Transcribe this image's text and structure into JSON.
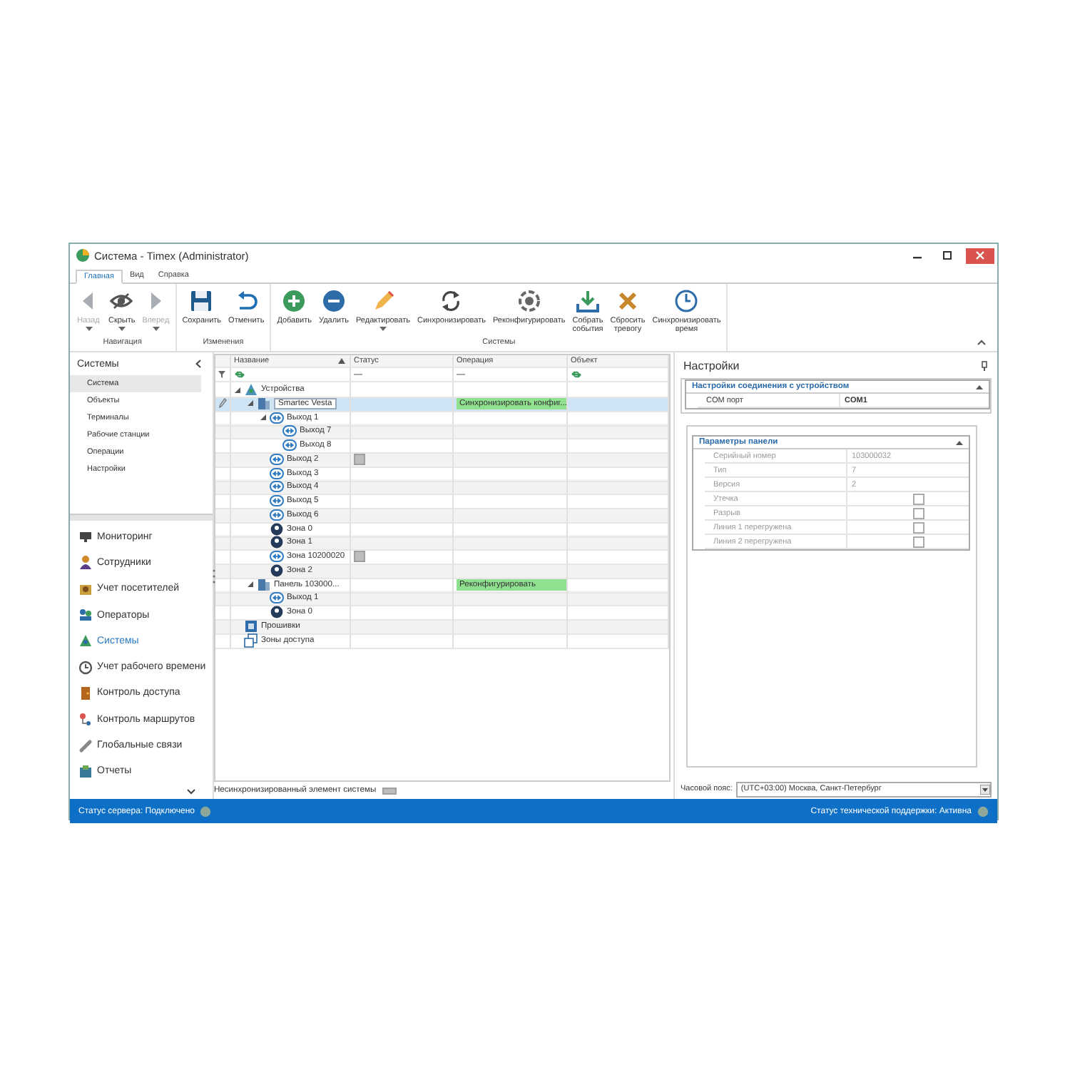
{
  "window": {
    "title": "Система - Timex (Administrator)"
  },
  "ribbon": {
    "tabs": [
      {
        "label": "Главная",
        "selected": true
      },
      {
        "label": "Вид",
        "selected": false
      },
      {
        "label": "Справка",
        "selected": false
      }
    ],
    "groups": [
      {
        "label": "Навигация",
        "buttons": [
          {
            "label": "Назад",
            "disabled": true,
            "dropdown": true
          },
          {
            "label": "Скрыть",
            "disabled": false,
            "dropdown": true
          },
          {
            "label": "Вперед",
            "disabled": true,
            "dropdown": true
          }
        ]
      },
      {
        "label": "Изменения",
        "buttons": [
          {
            "label": "Сохранить",
            "disabled": false,
            "dropdown": false
          },
          {
            "label": "Отменить",
            "disabled": false,
            "dropdown": false
          }
        ]
      },
      {
        "label": "Системы",
        "buttons": [
          {
            "label": "Добавить",
            "disabled": false,
            "dropdown": false
          },
          {
            "label": "Удалить",
            "disabled": false,
            "dropdown": false
          },
          {
            "label": "Редактировать",
            "disabled": false,
            "dropdown": true
          },
          {
            "label": "Синхронизировать",
            "disabled": false,
            "dropdown": false
          },
          {
            "label": "Реконфигурировать",
            "disabled": false,
            "dropdown": false
          },
          {
            "label": "Собрать\nсобытия",
            "disabled": false,
            "dropdown": false
          },
          {
            "label": "Сбросить\nтревогу",
            "disabled": false,
            "dropdown": false
          },
          {
            "label": "Синхронизировать\nвремя",
            "disabled": false,
            "dropdown": false
          }
        ]
      }
    ]
  },
  "nav": {
    "header": "Системы",
    "subitems": [
      {
        "label": "Система",
        "selected": true
      },
      {
        "label": "Объекты",
        "selected": false
      },
      {
        "label": "Терминалы",
        "selected": false
      },
      {
        "label": "Рабочие станции",
        "selected": false
      },
      {
        "label": "Операции",
        "selected": false
      },
      {
        "label": "Настройки",
        "selected": false
      }
    ],
    "items": [
      {
        "label": "Мониторинг",
        "selected": false
      },
      {
        "label": "Сотрудники",
        "selected": false
      },
      {
        "label": "Учет посетителей",
        "selected": false
      },
      {
        "label": "Операторы",
        "selected": false
      },
      {
        "label": "Системы",
        "selected": true
      },
      {
        "label": "Учет рабочего времени",
        "selected": false
      },
      {
        "label": "Контроль доступа",
        "selected": false
      },
      {
        "label": "Контроль маршрутов",
        "selected": false
      },
      {
        "label": "Глобальные связи",
        "selected": false
      },
      {
        "label": "Отчеты",
        "selected": false
      }
    ]
  },
  "tree": {
    "columns": [
      {
        "label": "Название",
        "sorted": true
      },
      {
        "label": "Статус",
        "sorted": false
      },
      {
        "label": "Операция",
        "sorted": false
      },
      {
        "label": "Объект",
        "sorted": false
      }
    ],
    "filter": [
      {
        "kind": "any"
      },
      {
        "kind": "text",
        "text": "—"
      },
      {
        "kind": "text",
        "text": "—"
      },
      {
        "kind": "any"
      }
    ],
    "rows": [
      {
        "name": "Устройства",
        "kind": "network",
        "expanded": true,
        "unsynced": false,
        "selected": false,
        "children": [
          {
            "name": "Smartec Vesta",
            "kind": "device",
            "expanded": true,
            "unsynced": false,
            "selected": true,
            "operation": "Синхронизировать конфиг...",
            "children": [
              {
                "name": "Выход 1",
                "kind": "output",
                "expanded": true,
                "unsynced": false,
                "selected": false,
                "children": [
                  {
                    "name": "Выход 7",
                    "kind": "output",
                    "unsynced": false,
                    "selected": false
                  },
                  {
                    "name": "Выход 8",
                    "kind": "output",
                    "unsynced": false,
                    "selected": false
                  }
                ]
              },
              {
                "name": "Выход 2",
                "kind": "output",
                "unsynced": true,
                "selected": false
              },
              {
                "name": "Выход 3",
                "kind": "output",
                "unsynced": false,
                "selected": false
              },
              {
                "name": "Выход 4",
                "kind": "output",
                "unsynced": false,
                "selected": false
              },
              {
                "name": "Выход 5",
                "kind": "output",
                "unsynced": false,
                "selected": false
              },
              {
                "name": "Выход 6",
                "kind": "output",
                "unsynced": false,
                "selected": false
              },
              {
                "name": "Зона 0",
                "kind": "zone",
                "unsynced": false,
                "selected": false
              },
              {
                "name": "Зона 1",
                "kind": "zone",
                "unsynced": false,
                "selected": false
              },
              {
                "name": "Зона 10200020",
                "kind": "output",
                "unsynced": true,
                "selected": false
              },
              {
                "name": "Зона 2",
                "kind": "zone",
                "unsynced": false,
                "selected": false
              }
            ]
          },
          {
            "name": "Панель 103000...",
            "kind": "device",
            "expanded": true,
            "unsynced": false,
            "selected": false,
            "operation": "Реконфигурировать",
            "children": [
              {
                "name": "Выход 1",
                "kind": "output",
                "unsynced": false,
                "selected": false
              },
              {
                "name": "Зона 0",
                "kind": "zone",
                "unsynced": false,
                "selected": false
              }
            ]
          }
        ]
      },
      {
        "name": "Прошивки",
        "kind": "firmware",
        "unsynced": false,
        "selected": false
      },
      {
        "name": "Зоны доступа",
        "kind": "areas",
        "unsynced": false,
        "selected": false
      }
    ]
  },
  "legend": "Несинхронизированный элемент системы",
  "settings": {
    "title": "Настройки",
    "sections": [
      {
        "title": "Настройки соединения с устройством",
        "expanded": true,
        "readonly": false,
        "rows": [
          {
            "kind": "text",
            "label": "COM порт",
            "value": "COM1"
          }
        ]
      },
      {
        "title": "Параметры панели",
        "expanded": true,
        "readonly": true,
        "rows": [
          {
            "kind": "text",
            "label": "Серийный номер",
            "value": "103000032"
          },
          {
            "kind": "text",
            "label": "Тип",
            "value": "7"
          },
          {
            "kind": "text",
            "label": "Версия",
            "value": "2"
          },
          {
            "kind": "checkbox",
            "label": "Утечка",
            "checked": false
          },
          {
            "kind": "checkbox",
            "label": "Разрыв",
            "checked": false
          },
          {
            "kind": "checkbox",
            "label": "Линия 1 перегружена",
            "checked": false
          },
          {
            "kind": "checkbox",
            "label": "Линия 2 перегружена",
            "checked": false
          }
        ]
      }
    ],
    "timezone": {
      "label": "Часовой пояс:",
      "value": "(UTC+03:00) Москва, Санкт-Петербург"
    }
  },
  "status_bar": {
    "left": "Статус сервера: Подключено",
    "right": "Статус технической поддержки: Активна"
  }
}
